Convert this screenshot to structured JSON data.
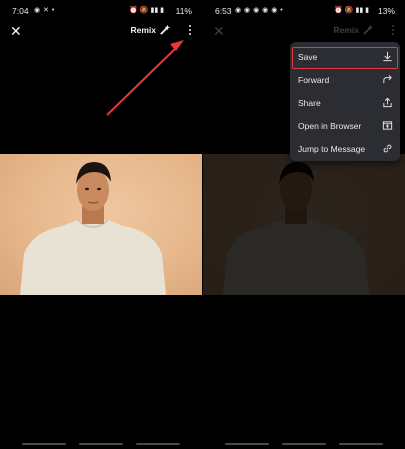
{
  "left_screen": {
    "status": {
      "time": "7:04",
      "battery": "11%",
      "left_icons": "◉ ✕ •",
      "right_icons": "⏰ 🔕 ▮▮ ▮"
    },
    "toolbar": {
      "remix_label": "Remix"
    }
  },
  "right_screen": {
    "status": {
      "time": "6:53",
      "battery": "13%",
      "left_icons": "◉ ◉ ◉ ◉ ◉ •",
      "right_icons": "⏰ 🔕 ▮▮ ▮"
    },
    "toolbar": {
      "remix_label": "Remix"
    },
    "menu": {
      "items": [
        {
          "label": "Save",
          "icon": "download-icon",
          "highlighted": true
        },
        {
          "label": "Forward",
          "icon": "forward-arrow-icon"
        },
        {
          "label": "Share",
          "icon": "share-icon"
        },
        {
          "label": "Open in Browser",
          "icon": "open-browser-icon"
        },
        {
          "label": "Jump to Message",
          "icon": "link-icon"
        }
      ]
    }
  },
  "colors": {
    "annotation_red": "#e0393e",
    "menu_bg": "#2c2d32",
    "photo_bg": "#e7b78c"
  }
}
